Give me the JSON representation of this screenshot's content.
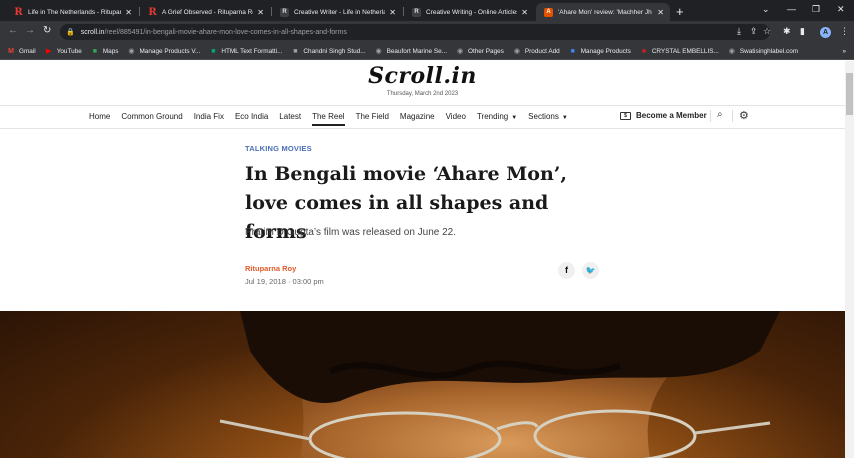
{
  "browser": {
    "tabs": [
      {
        "title": "Life in The Netherlands - Ritupar",
        "favicon": "r-icon",
        "active": false
      },
      {
        "title": "A Grief Observed - Rituparna Roy",
        "favicon": "r-icon",
        "active": false
      },
      {
        "title": "Creative Writer - Life in Netherla",
        "favicon": "scroll-icon",
        "active": false
      },
      {
        "title": "Creative Writing - Online Articles",
        "favicon": "scroll-icon",
        "active": false
      },
      {
        "title": "'Ahare Mon' review: 'Machher Jh",
        "favicon": "article-icon",
        "active": true
      }
    ],
    "new_tab": "+",
    "address": {
      "host": "scroll.in",
      "path": "/reel/885491/in-bengali-movie-ahare-mon-love-comes-in-all-shapes-and-forms"
    },
    "profile_initial": "A",
    "bookmarks": [
      {
        "label": "Gmail",
        "icon": "gmail-icon",
        "color": "#ea4335"
      },
      {
        "label": "YouTube",
        "icon": "youtube-icon",
        "color": "#ff0000"
      },
      {
        "label": "Maps",
        "icon": "maps-icon",
        "color": "#34a853"
      },
      {
        "label": "Manage Products V...",
        "icon": "globe-icon",
        "color": "#9aa0a6"
      },
      {
        "label": "HTML Text Formatti...",
        "icon": "w3-icon",
        "color": "#04aa6d"
      },
      {
        "label": "Chandni Singh Stud...",
        "icon": "page-icon",
        "color": "#9aa0a6"
      },
      {
        "label": "Beaufort Marine Se...",
        "icon": "globe-icon",
        "color": "#9aa0a6"
      },
      {
        "label": "Other Pages",
        "icon": "globe-icon",
        "color": "#9aa0a6"
      },
      {
        "label": "Product Add",
        "icon": "globe-icon",
        "color": "#9aa0a6"
      },
      {
        "label": "Manage Products",
        "icon": "shop-icon",
        "color": "#4285f4"
      },
      {
        "label": "CRYSTAL EMBELLIS...",
        "icon": "crystal-icon",
        "color": "#c5221f"
      },
      {
        "label": "Swatisinghlabel.com",
        "icon": "globe-icon",
        "color": "#9aa0a6"
      }
    ],
    "bookmarks_more": "»"
  },
  "site": {
    "logo": "Scroll.in",
    "date": "Thursday, March 2nd 2023",
    "nav": [
      "Home",
      "Common Ground",
      "India Fix",
      "Eco India",
      "Latest",
      "The Reel",
      "The Field",
      "Magazine",
      "Video",
      "Trending",
      "Sections"
    ],
    "nav_active": "The Reel",
    "member_icon_text": "$",
    "member_label": "Become a Member"
  },
  "article": {
    "kicker": "TALKING MOVIES",
    "headline": "In Bengali movie ‘Ahare Mon’, love comes in all shapes and forms",
    "dek": "Pratim D Gupta’s film was released on June 22.",
    "author": "Rituparna Roy",
    "published": "Jul 19, 2018 · 03:00 pm",
    "share": [
      {
        "icon": "facebook-icon",
        "glyph": "f"
      },
      {
        "icon": "twitter-icon",
        "glyph": "🐦"
      }
    ]
  },
  "colors": {
    "kicker": "#4a6fb5",
    "author": "#e35a28",
    "chrome_dark": "#202124",
    "chrome": "#35363a"
  }
}
